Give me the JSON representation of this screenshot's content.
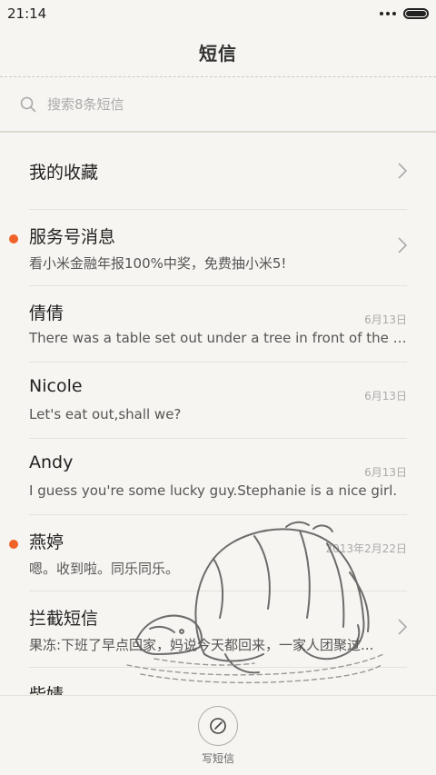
{
  "status_bar": {
    "time": "21:14"
  },
  "header": {
    "title": "短信"
  },
  "search": {
    "placeholder": "搜索8条短信"
  },
  "conversations": [
    {
      "name": "我的收藏",
      "preview": "",
      "date": "",
      "unread": false,
      "chevron": true
    },
    {
      "name": "服务号消息",
      "preview": "看小米金融年报100%中奖，免费抽小米5!",
      "date": "",
      "unread": true,
      "chevron": true
    },
    {
      "name": "倩倩",
      "preview": "There was a table set out under a tree in front of the ho...",
      "date": "6月13日",
      "unread": false,
      "chevron": false
    },
    {
      "name": "Nicole",
      "preview": "Let's eat out,shall we?",
      "date": "6月13日",
      "unread": false,
      "chevron": false
    },
    {
      "name": "Andy",
      "preview": "I guess you're some lucky guy.Stephanie is a nice girl.",
      "date": "6月13日",
      "unread": false,
      "chevron": false
    },
    {
      "name": "燕婷",
      "preview": "嗯。收到啦。同乐同乐。",
      "date": "2013年2月22日",
      "unread": true,
      "chevron": false
    },
    {
      "name": "拦截短信",
      "preview": "果冻:下班了早点回家，妈说今天都回来，一家人团聚过...",
      "date": "",
      "unread": false,
      "chevron": true
    },
    {
      "name": "柴婧",
      "preview": "",
      "date": "",
      "unread": false,
      "chevron": false
    }
  ],
  "footer": {
    "compose_label": "写短信"
  },
  "colors": {
    "unread_dot": "#f0622a",
    "background": "#f7f5f1"
  }
}
